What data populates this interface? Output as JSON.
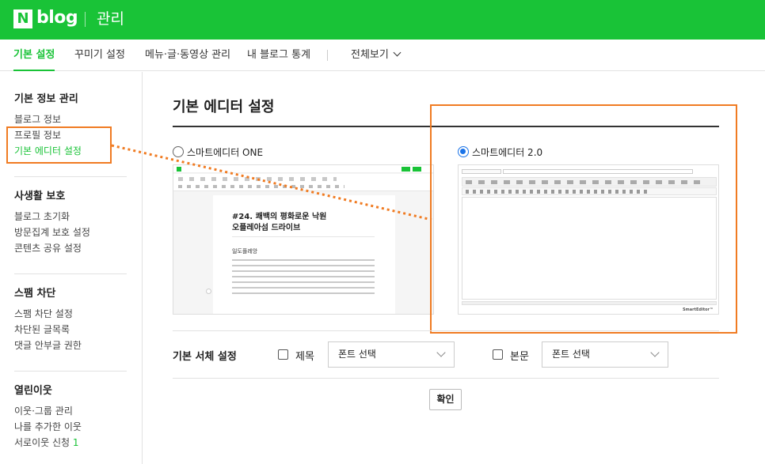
{
  "header": {
    "logo_n": "N",
    "logo_text": "blog",
    "title": "관리"
  },
  "topnav": {
    "items": [
      {
        "label": "기본 설정",
        "active": true
      },
      {
        "label": "꾸미기 설정",
        "active": false
      },
      {
        "label": "메뉴·글·동영상 관리",
        "active": false
      },
      {
        "label": "내 블로그 통계",
        "active": false
      }
    ],
    "view_all": "전체보기"
  },
  "sidebar": {
    "sections": [
      {
        "title": "기본 정보 관리",
        "items": [
          {
            "label": "블로그 정보"
          },
          {
            "label": "프로필 정보"
          },
          {
            "label": "기본 에디터 설정",
            "active": true
          }
        ]
      },
      {
        "title": "사생활 보호",
        "items": [
          {
            "label": "블로그 초기화"
          },
          {
            "label": "방문집계 보호 설정"
          },
          {
            "label": "콘텐츠 공유 설정"
          }
        ]
      },
      {
        "title": "스팸 차단",
        "items": [
          {
            "label": "스팸 차단 설정"
          },
          {
            "label": "차단된 글목록"
          },
          {
            "label": "댓글 안부글 권한"
          }
        ]
      },
      {
        "title": "열린이웃",
        "items": [
          {
            "label": "이웃·그룹 관리"
          },
          {
            "label": "나를 추가한 이웃"
          },
          {
            "label": "서로이웃 신청",
            "count": "1"
          }
        ]
      }
    ]
  },
  "main": {
    "title": "기본 에디터 설정",
    "editor_one": {
      "label": "스마트에디터 ONE",
      "selected": false,
      "preview_title_line1": "#24. 쾌백의 평화로운 낙원",
      "preview_title_line2": "오플레아섬 드라이브",
      "preview_subtitle": "일도플레앙"
    },
    "editor_two": {
      "label": "스마트에디터 2.0",
      "selected": true,
      "preview_brand": "SmartEditor™"
    },
    "font_settings": {
      "label": "기본 서체 설정",
      "title_checkbox": "제목",
      "title_select": "폰트 선택",
      "body_checkbox": "본문",
      "body_select": "폰트 선택"
    },
    "confirm": "확인"
  },
  "colors": {
    "brand": "#19c337",
    "highlight": "#f07b22",
    "radio": "#1a73e8"
  }
}
